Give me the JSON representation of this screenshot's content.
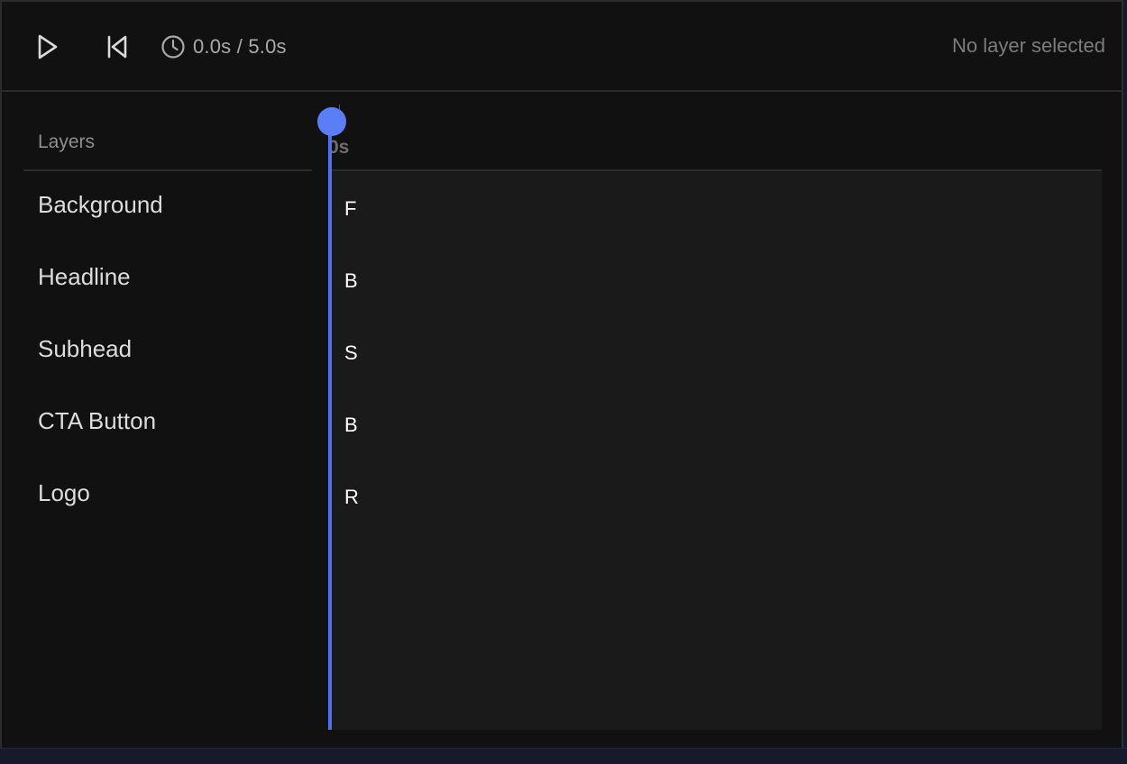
{
  "toolbar": {
    "play_icon": "play-icon",
    "restart_icon": "skip-to-start-icon",
    "clock_icon": "clock-icon",
    "time_display": "0.0s / 5.0s",
    "selection_status": "No layer selected"
  },
  "layers_panel": {
    "title": "Layers",
    "items": [
      {
        "label": "Background"
      },
      {
        "label": "Headline"
      },
      {
        "label": "Subhead"
      },
      {
        "label": "CTA Button"
      },
      {
        "label": "Logo"
      }
    ]
  },
  "timeline": {
    "ruler_label": "0s",
    "clips": [
      {
        "label": "F"
      },
      {
        "label": "B"
      },
      {
        "label": "S"
      },
      {
        "label": "B"
      },
      {
        "label": "R"
      }
    ],
    "playhead_color": "#5b7ef7"
  },
  "colors": {
    "background": "#111111",
    "accent": "#5b7ef7",
    "track_area": "#1a1a1a"
  }
}
